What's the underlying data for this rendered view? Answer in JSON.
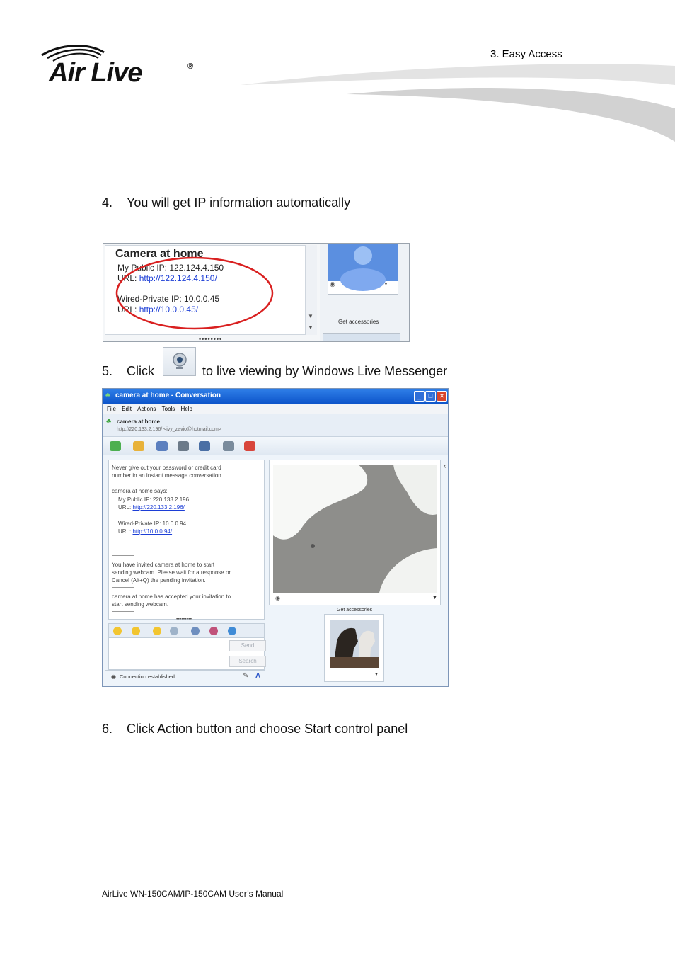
{
  "header": {
    "brand": "Air Live",
    "registered": "®",
    "chapter": "3.  Easy  Access"
  },
  "steps": [
    {
      "number": "4.",
      "text": "You will get IP information automatically"
    },
    {
      "number": "5.",
      "text_before": "Click",
      "text_after": "to live viewing by Windows Live Messenger"
    },
    {
      "number": "6.",
      "text": "Click Action button and choose Start control panel"
    }
  ],
  "screenshot1": {
    "heading": "Camera at home",
    "public_ip": "My Public IP: 122.124.4.150",
    "url_label": "URL:",
    "public_url": "http://122.124.4.150/",
    "private_ip": "Wired-Private IP: 10.0.0.45",
    "private_url": "http://10.0.0.45/",
    "accessories": "Get accessories"
  },
  "screenshot2": {
    "title": "camera at home - Conversation",
    "menu": [
      "File",
      "Edit",
      "Actions",
      "Tools",
      "Help"
    ],
    "contact_name": "camera at home",
    "contact_sub": "http://220.133.2.196/ <ivy_zavio@hotmail.com>",
    "warning_1": "Never give out your password or credit card",
    "warning_2": "number in an instant message conversation.",
    "says": "camera at home says:",
    "public_ip": "My Public IP: 220.133.2.196",
    "url_label": "URL:",
    "public_url": "http://220.133.2.196/",
    "private_ip": "Wired-Private IP: 10.0.0.94",
    "private_url": "http://10.0.0.94/",
    "invite_1": "You have invited camera at home to start",
    "invite_2": "sending webcam. Please wait for a response or",
    "invite_3": "Cancel (Alt+Q) the pending invitation.",
    "accept_1": "camera at home has accepted your invitation to",
    "accept_2": "start sending webcam.",
    "send": "Send",
    "search": "Search",
    "status": "Connection established.",
    "accessories": "Get accessories"
  },
  "footer": "AirLive WN-150CAM/IP-150CAM User’s Manual",
  "colors": {
    "link": "#1c3ed6",
    "annotation": "#d92020",
    "titlebar": "#0c53c9"
  }
}
